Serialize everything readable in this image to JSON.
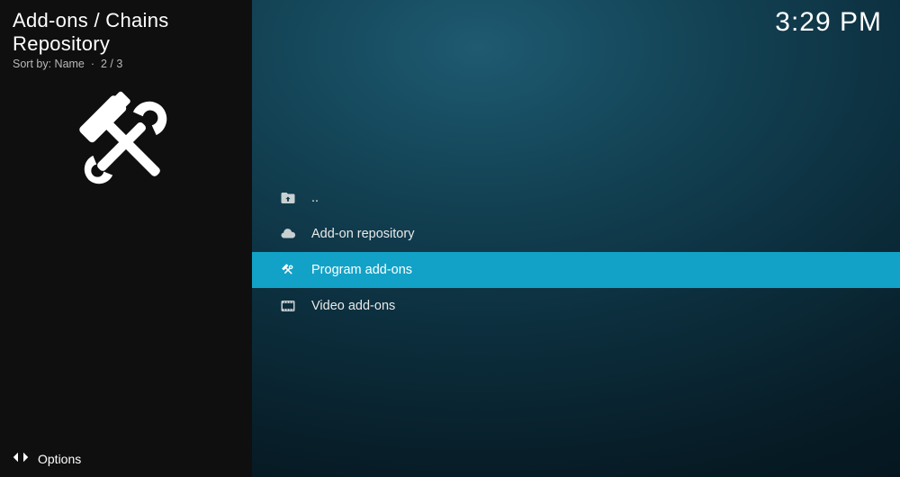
{
  "header": {
    "breadcrumb": "Add-ons / Chains Repository",
    "sort_label": "Sort by: Name",
    "separator": "·",
    "position": "2 / 3"
  },
  "clock": "3:29 PM",
  "sidebar": {
    "icon": "tools-icon"
  },
  "list": {
    "items": [
      {
        "icon": "folder-up-icon",
        "label": "..",
        "selected": false
      },
      {
        "icon": "cloud-icon",
        "label": "Add-on repository",
        "selected": false
      },
      {
        "icon": "tools-icon",
        "label": "Program add-ons",
        "selected": true
      },
      {
        "icon": "film-icon",
        "label": "Video add-ons",
        "selected": false
      }
    ]
  },
  "footer": {
    "options_label": "Options"
  }
}
